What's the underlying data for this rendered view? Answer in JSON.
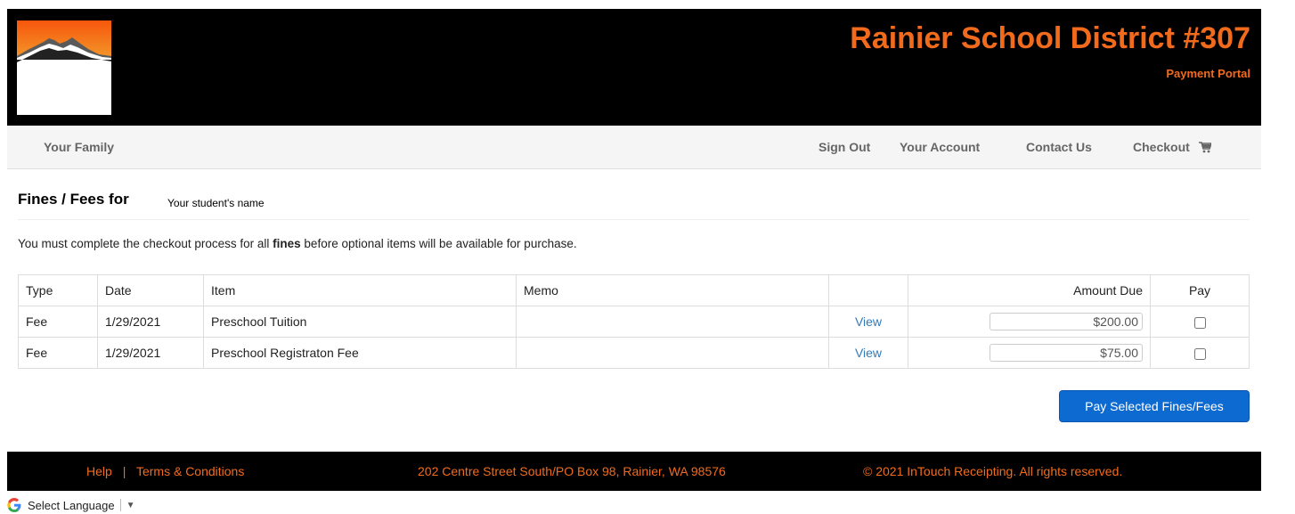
{
  "header": {
    "title": "Rainier School District #307",
    "subtitle": "Payment Portal",
    "logo_icon": "mountain-logo-icon",
    "accent_color": "#f26b1d"
  },
  "nav": {
    "left": "Your Family",
    "sign_out": "Sign Out",
    "your_account": "Your Account",
    "contact_us": "Contact Us",
    "checkout": "Checkout",
    "checkout_icon": "cart-icon"
  },
  "main": {
    "section_title": "Fines / Fees for",
    "student_name": "Your student's name",
    "notice_before": "You must complete the checkout process for all ",
    "notice_bold": "fines",
    "notice_after": " before optional items will be available for purchase.",
    "table": {
      "headers": {
        "type": "Type",
        "date": "Date",
        "item": "Item",
        "memo": "Memo",
        "view": "",
        "amount_due": "Amount Due",
        "pay": "Pay"
      },
      "rows": [
        {
          "type": "Fee",
          "date": "1/29/2021",
          "item": "Preschool Tuition",
          "memo": "",
          "view": "View",
          "amount": "$200.00",
          "pay_checked": false
        },
        {
          "type": "Fee",
          "date": "1/29/2021",
          "item": "Preschool Registraton Fee",
          "memo": "",
          "view": "View",
          "amount": "$75.00",
          "pay_checked": false
        }
      ]
    },
    "pay_button": "Pay Selected Fines/Fees",
    "button_color": "#0d6ad1"
  },
  "footer": {
    "help": "Help",
    "separator": "|",
    "terms": "Terms & Conditions",
    "address": "202 Centre Street South/PO Box 98, Rainier, WA 98576",
    "copyright": "© 2021 InTouch Receipting. All rights reserved."
  },
  "language": {
    "label": "Select Language",
    "icon": "google-g-icon",
    "arrow": "▼"
  }
}
